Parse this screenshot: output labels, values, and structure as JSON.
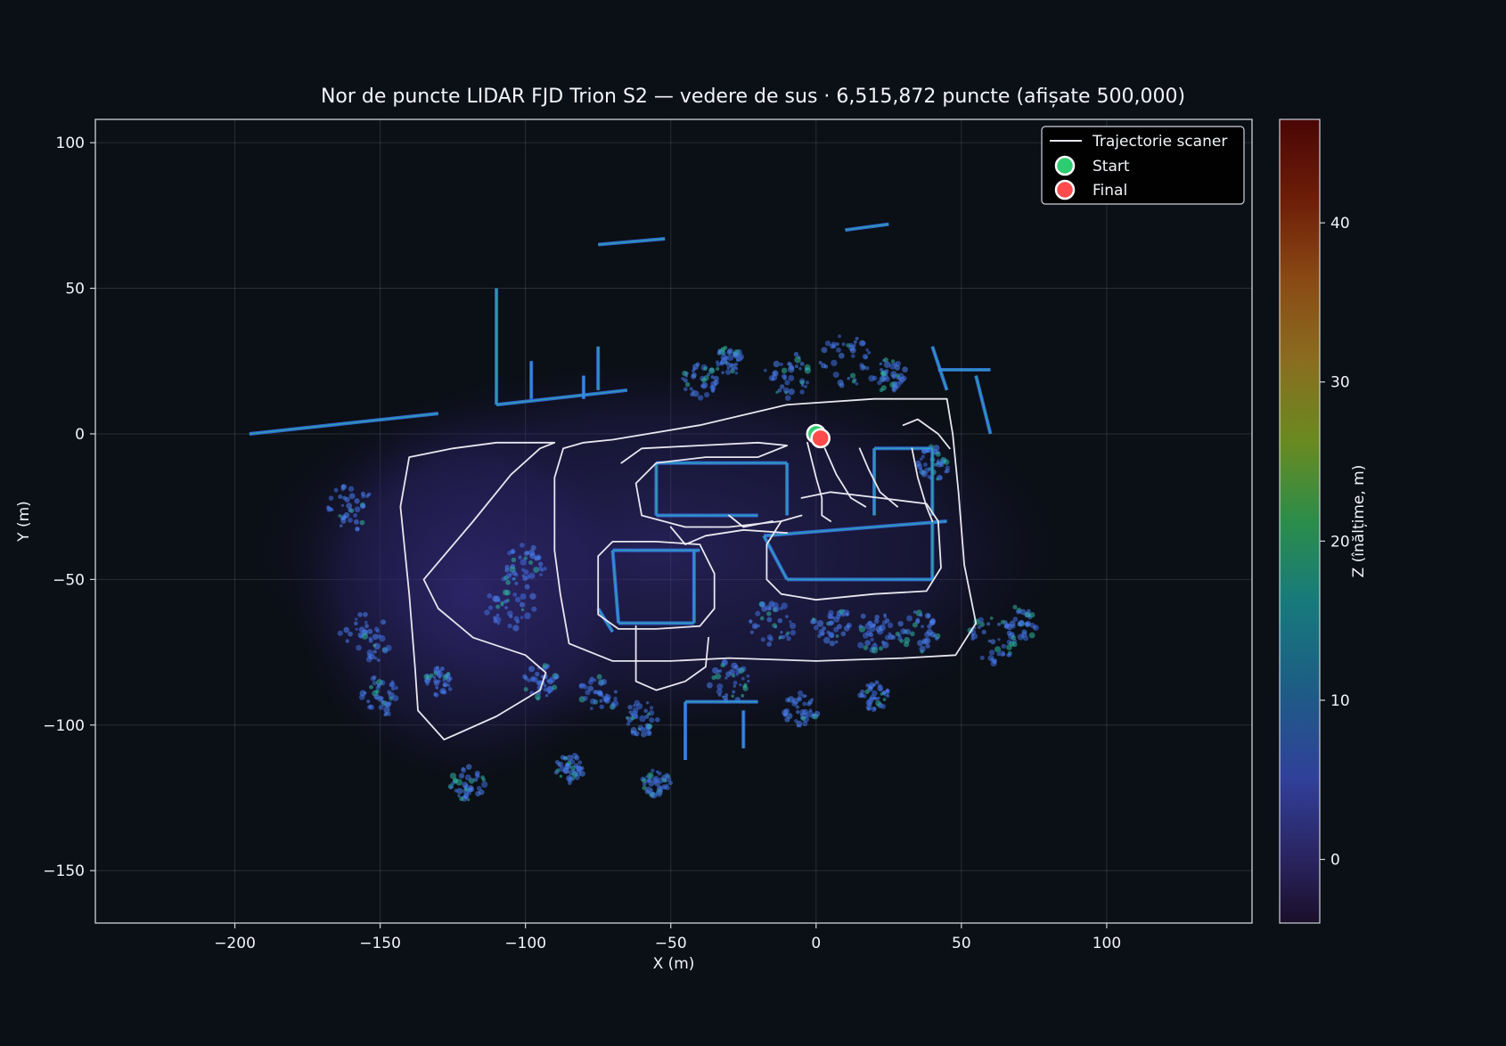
{
  "chart_data": {
    "type": "scatter",
    "title": "Nor de puncte LIDAR FJD Trion S2 — vedere de sus  ·  6,515,872 puncte (afișate 500,000)",
    "xlabel": "X (m)",
    "ylabel": "Y (m)",
    "xlim": [
      -248,
      150
    ],
    "ylim": [
      -168,
      108
    ],
    "xticks": [
      -200,
      -150,
      -100,
      -50,
      0,
      50,
      100
    ],
    "yticks": [
      100,
      50,
      0,
      -50,
      -100,
      -150
    ],
    "xtick_labels": [
      "−200",
      "−150",
      "−100",
      "−50",
      "0",
      "50",
      "100"
    ],
    "ytick_labels": [
      "100",
      "50",
      "0",
      "−50",
      "−100",
      "−150"
    ],
    "grid": true,
    "legend_position": "top-right",
    "legend": [
      {
        "label": "Trajectorie scaner",
        "kind": "line",
        "color": "#e8e6ef"
      },
      {
        "label": "Start",
        "kind": "marker",
        "color": "#2ecc71"
      },
      {
        "label": "Final",
        "kind": "marker",
        "color": "#ff4b4b"
      }
    ],
    "colorbar": {
      "label": "Z (înălțime, m)",
      "range": [
        -4,
        46.5
      ],
      "ticks": [
        0,
        10,
        20,
        30,
        40
      ],
      "tick_labels": [
        "0",
        "10",
        "20",
        "30",
        "40"
      ],
      "colormap": "turbo-dark"
    },
    "start_point": {
      "x": 0,
      "y": 0
    },
    "end_point": {
      "x": 1.5,
      "y": -1.5
    },
    "trajectory_segments": [
      [
        [
          -80,
          -3
        ],
        [
          -87,
          -5
        ],
        [
          -90,
          -15
        ],
        [
          -90,
          -40
        ],
        [
          -88,
          -55
        ],
        [
          -85,
          -72
        ],
        [
          -70,
          -78
        ],
        [
          -50,
          -78
        ],
        [
          -30,
          -77
        ],
        [
          0,
          -78
        ],
        [
          30,
          -77
        ],
        [
          48,
          -76
        ],
        [
          55,
          -65
        ],
        [
          51,
          -45
        ],
        [
          49,
          -20
        ],
        [
          47,
          0
        ],
        [
          45,
          12
        ],
        [
          20,
          12
        ],
        [
          -10,
          10
        ],
        [
          -40,
          3
        ],
        [
          -70,
          -2
        ],
        [
          -80,
          -3
        ]
      ],
      [
        [
          -90,
          -3
        ],
        [
          -110,
          -3
        ],
        [
          -125,
          -5
        ],
        [
          -140,
          -8
        ],
        [
          -143,
          -25
        ],
        [
          -140,
          -55
        ],
        [
          -138,
          -80
        ],
        [
          -137,
          -95
        ],
        [
          -128,
          -105
        ],
        [
          -110,
          -97
        ],
        [
          -95,
          -88
        ],
        [
          -93,
          -82
        ],
        [
          -100,
          -76
        ],
        [
          -118,
          -70
        ],
        [
          -130,
          -60
        ],
        [
          -135,
          -50
        ],
        [
          -118,
          -30
        ],
        [
          -105,
          -14
        ],
        [
          -95,
          -5
        ],
        [
          -90,
          -3
        ]
      ],
      [
        [
          -67,
          -10
        ],
        [
          -60,
          -5
        ],
        [
          -40,
          -4
        ],
        [
          -20,
          -3
        ],
        [
          -10,
          -4
        ],
        [
          -20,
          -8
        ],
        [
          -38,
          -8
        ],
        [
          -55,
          -10
        ],
        [
          -62,
          -17
        ],
        [
          -60,
          -28
        ],
        [
          -45,
          -32
        ],
        [
          -30,
          -32
        ],
        [
          -12,
          -30
        ],
        [
          -5,
          -28
        ]
      ],
      [
        [
          -50,
          -32
        ],
        [
          -45,
          -38
        ],
        [
          -38,
          -35
        ],
        [
          -25,
          -33
        ],
        [
          -10,
          -34
        ]
      ],
      [
        [
          -12,
          -30
        ],
        [
          -17,
          -38
        ],
        [
          -17,
          -50
        ],
        [
          -12,
          -55
        ],
        [
          0,
          -57
        ],
        [
          20,
          -55
        ],
        [
          38,
          -54
        ],
        [
          43,
          -46
        ],
        [
          42,
          -30
        ],
        [
          38,
          -24
        ],
        [
          22,
          -22
        ],
        [
          5,
          -20
        ],
        [
          -5,
          -22
        ]
      ],
      [
        [
          -70,
          -37
        ],
        [
          -75,
          -42
        ],
        [
          -75,
          -62
        ],
        [
          -68,
          -67
        ],
        [
          -55,
          -67
        ],
        [
          -40,
          -66
        ],
        [
          -35,
          -60
        ],
        [
          -35,
          -48
        ],
        [
          -40,
          -38
        ],
        [
          -55,
          -37
        ],
        [
          -70,
          -37
        ]
      ],
      [
        [
          -62,
          -66
        ],
        [
          -62,
          -85
        ],
        [
          -55,
          -88
        ],
        [
          -45,
          -85
        ],
        [
          -38,
          -80
        ],
        [
          -37,
          -70
        ]
      ],
      [
        [
          -3,
          -3
        ],
        [
          0,
          -15
        ],
        [
          2,
          -22
        ],
        [
          2,
          -28
        ],
        [
          5,
          -30
        ]
      ],
      [
        [
          3,
          -5
        ],
        [
          7,
          -14
        ],
        [
          12,
          -22
        ],
        [
          17,
          -25
        ]
      ],
      [
        [
          15,
          -5
        ],
        [
          18,
          -12
        ],
        [
          22,
          -20
        ],
        [
          28,
          -25
        ]
      ],
      [
        [
          33,
          -5
        ],
        [
          35,
          -15
        ],
        [
          38,
          -25
        ],
        [
          40,
          -30
        ]
      ],
      [
        [
          30,
          3
        ],
        [
          35,
          5
        ],
        [
          42,
          0
        ],
        [
          46,
          -5
        ]
      ],
      [
        [
          -30,
          -28
        ],
        [
          -25,
          -32
        ],
        [
          -15,
          -30
        ]
      ]
    ]
  }
}
